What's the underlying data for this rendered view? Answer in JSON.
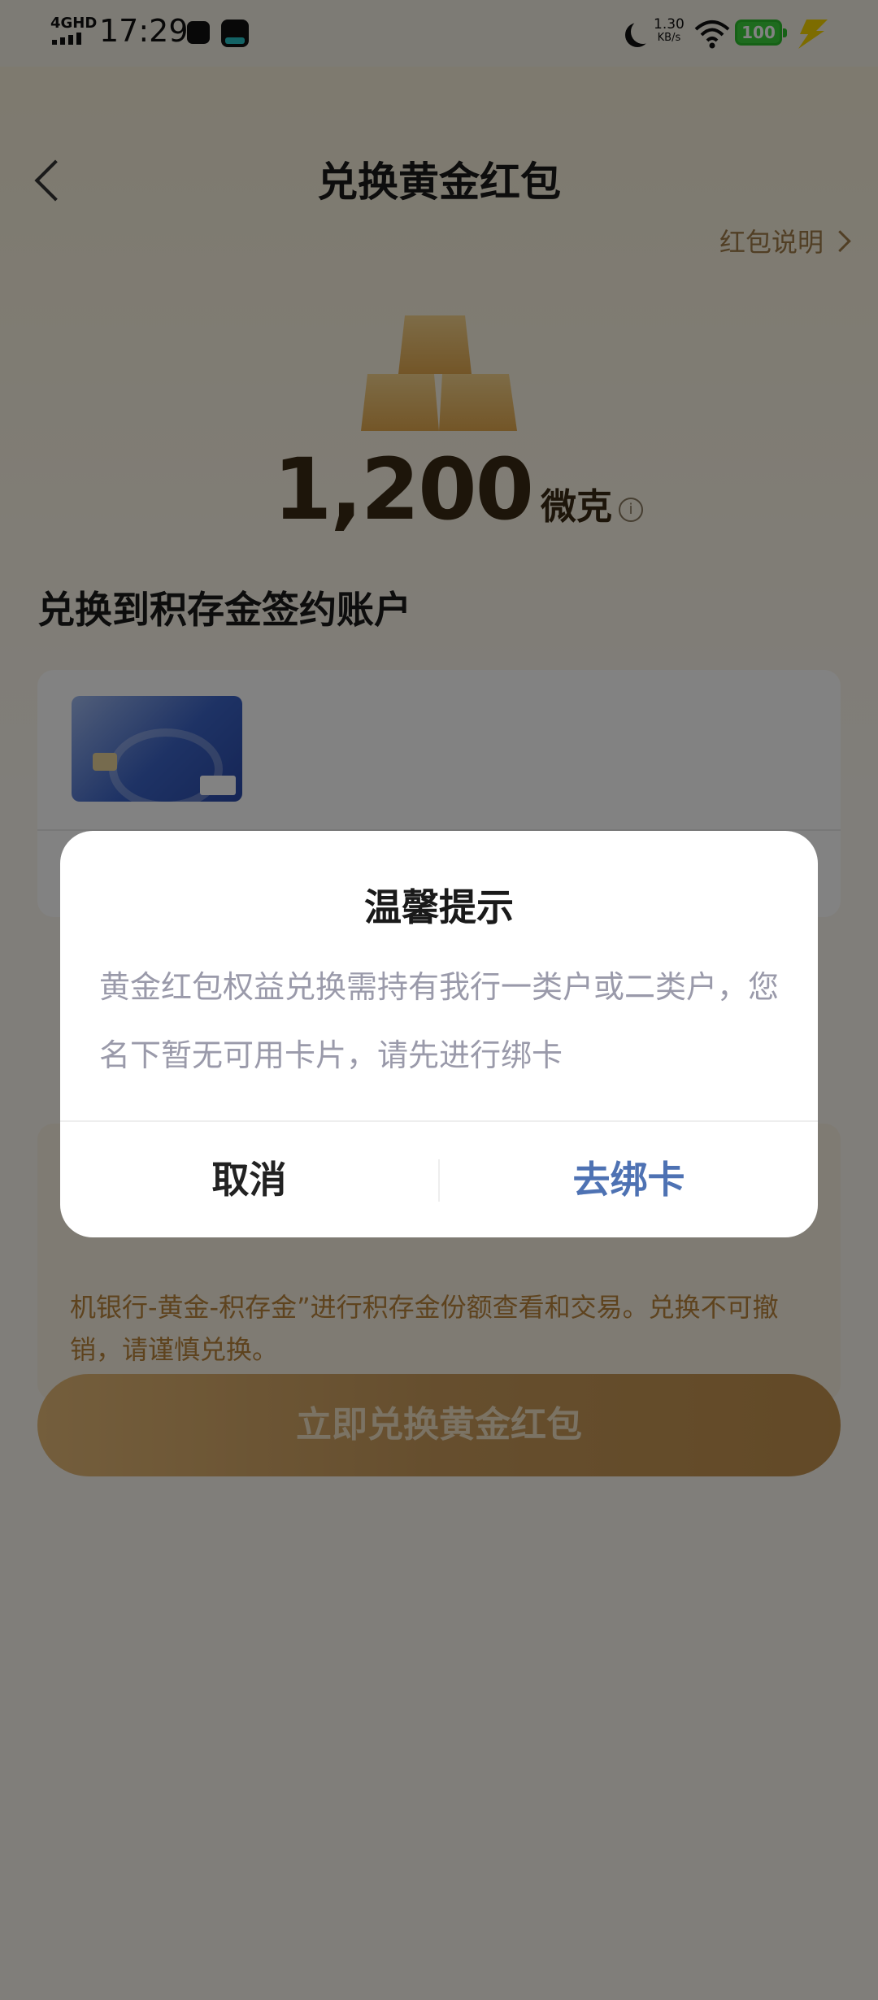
{
  "status_bar": {
    "network": "4GHD",
    "time": "17:29",
    "speed_value": "1.30",
    "speed_unit": "KB/s",
    "battery": "100"
  },
  "header": {
    "title": "兑换黄金红包",
    "explain_link": "红包说明"
  },
  "amount": {
    "value": "1,200",
    "unit": "微克"
  },
  "account_section": {
    "title": "兑换到积存金签约账户"
  },
  "notice": {
    "text_visible": "机银行-黄金-积存金”进行积存金份额查看和交易。兑换不可撤销，请谨慎兑换。"
  },
  "exchange_button": {
    "label": "立即兑换黄金红包"
  },
  "dialog": {
    "title": "温馨提示",
    "message": "黄金红包权益兑换需持有我行一类户或二类户，您名下暂无可用卡片，请先进行绑卡",
    "cancel_label": "取消",
    "confirm_label": "去绑卡"
  },
  "colors": {
    "accent_gold": "#c2914e",
    "dialog_confirm": "#4e72b3",
    "battery_green": "#3bd23b",
    "overlay": "rgba(0,0,0,0.49)"
  },
  "icons": [
    "back-icon",
    "chevron-right-icon",
    "info-icon",
    "gold-bars-icon",
    "wifi-icon",
    "battery-icon",
    "moon-icon",
    "charging-bolt-icon"
  ]
}
